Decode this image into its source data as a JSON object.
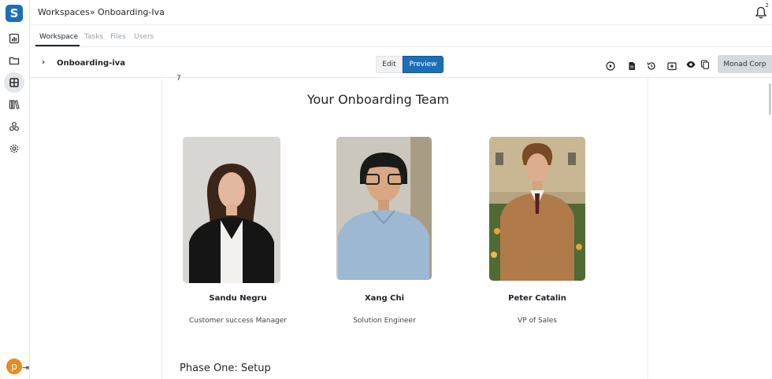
{
  "header": {
    "breadcrumb_root": "Workspaces",
    "breadcrumb_sep": "»",
    "breadcrumb_current": "Onboarding-Iva",
    "notification_count": "2"
  },
  "tabs": [
    {
      "label": "Workspace",
      "active": true
    },
    {
      "label": "Tasks",
      "active": false
    },
    {
      "label": "Files",
      "active": false
    },
    {
      "label": "Users",
      "active": false
    }
  ],
  "toolbar": {
    "doc_title": "Onboarding-iva",
    "edit_label": "Edit",
    "preview_label": "Preview",
    "org_label": "Monad Corp",
    "icons": [
      "play-icon",
      "document-icon",
      "history-icon",
      "add-page-icon",
      "eye-icon",
      "copy-icon"
    ]
  },
  "sidebar": {
    "icons": [
      "dashboard-icon",
      "folder-icon",
      "workspace-icon",
      "library-icon",
      "components-icon",
      "settings-icon"
    ],
    "avatar_letter": "p",
    "collapse_glyph": "⇥"
  },
  "content": {
    "stray_mark": "7",
    "team_title": "Your Onboarding Team",
    "members": [
      {
        "name": "Sandu Negru",
        "role": "Customer success Manager"
      },
      {
        "name": "Xang Chi",
        "role": "Solution Engineer"
      },
      {
        "name": "Peter Catalin",
        "role": "VP of Sales"
      }
    ],
    "next_heading": "Phase One: Setup"
  },
  "colors": {
    "accent": "#1c6fb6",
    "avatar": "#ea8a1f"
  }
}
